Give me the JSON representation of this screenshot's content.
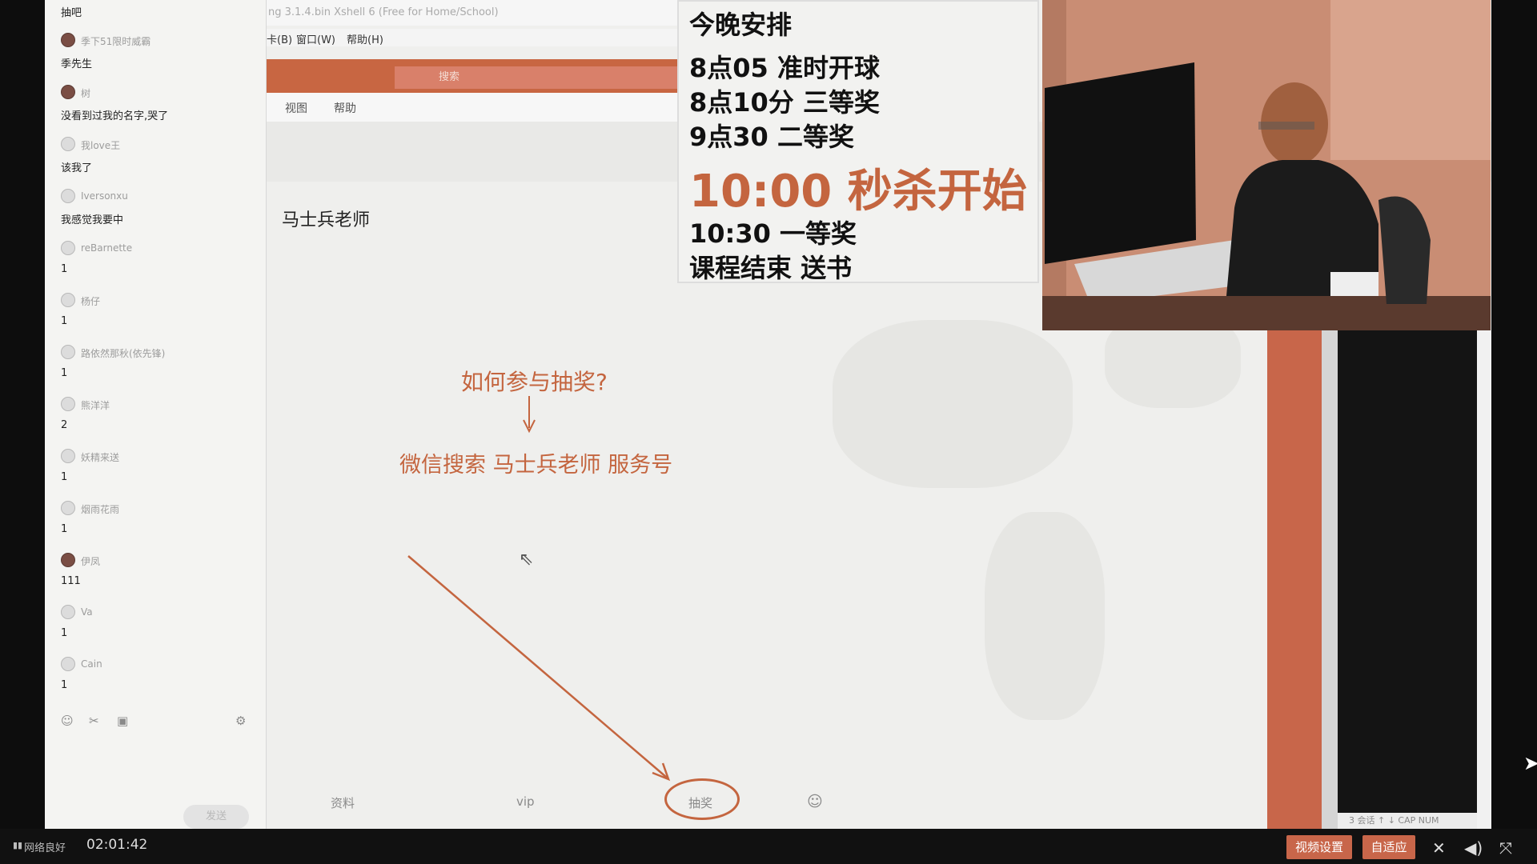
{
  "chat": {
    "top_label": "抽吧",
    "messages": [
      {
        "name": "季下51限时威霸",
        "text": "季先生"
      },
      {
        "name": "树",
        "text": "没看到过我的名字,哭了"
      },
      {
        "name": "我love王",
        "text": "该我了"
      },
      {
        "name": "Iversonxu",
        "text": "我感觉我要中"
      },
      {
        "name": "reBarnette",
        "text": "1"
      },
      {
        "name": "杨仔",
        "text": "1"
      },
      {
        "name": "路依然那秋(依先锋)",
        "text": "1"
      },
      {
        "name": "熊洋洋",
        "text": "2"
      },
      {
        "name": "妖精来送",
        "text": "1"
      },
      {
        "name": "烟雨花雨",
        "text": "1"
      },
      {
        "name": "伊凤",
        "text": "111"
      },
      {
        "name": "Va",
        "text": "1"
      },
      {
        "name": "Cain",
        "text": "1"
      }
    ],
    "tool_icons": [
      "smiley-icon",
      "scissors-icon",
      "image-icon",
      "settings-icon"
    ],
    "send_label": "发送"
  },
  "share": {
    "xshell_title": "ng 3.1.4.bin  Xshell 6 (Free for Home/School)",
    "menu": [
      "卡(B)",
      "窗口(W)",
      "帮助(H)"
    ],
    "search_placeholder": "搜索",
    "subnav": [
      "视图",
      "帮助"
    ],
    "teacher_name": "马士兵老师",
    "how_to": "如何参与抽奖?",
    "arrow": "↓",
    "wechat_search": "微信搜索 马士兵老师 服务号",
    "bottom_tabs": [
      "资料",
      "vip",
      "抽奖"
    ],
    "status_tiny": "3 会话   ↑ ↓   CAP NUM"
  },
  "schedule": {
    "title": "今晚安排",
    "items": [
      "8点05 准时开球",
      "8点10分 三等奖",
      "9点30 二等奖"
    ],
    "highlight": "10:00 秒杀开始",
    "items2": [
      "10:30 一等奖",
      "课程结束 送书"
    ],
    "highlight_color": "#c4653f"
  },
  "control_bar": {
    "network": "网络良好",
    "time": "02:01:42",
    "video_settings": "视频设置",
    "adaptive": "自适应"
  }
}
